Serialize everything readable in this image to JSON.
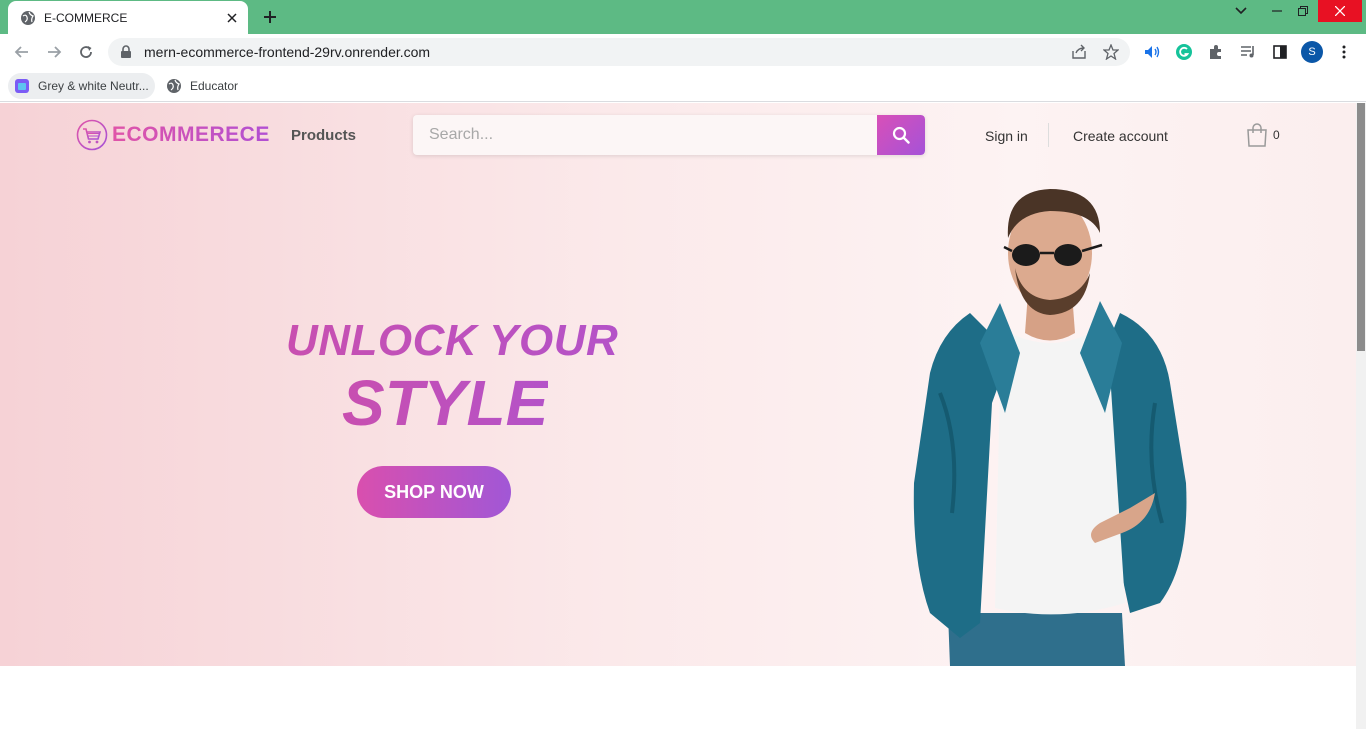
{
  "browser": {
    "tab_title": "E-COMMERCE",
    "url": "mern-ecommerce-frontend-29rv.onrender.com",
    "profile_initial": "S",
    "bookmarks": [
      {
        "label": "Grey & white Neutr..."
      },
      {
        "label": "Educator"
      }
    ]
  },
  "header": {
    "logo_text": "ECOMMERECE",
    "products_link": "Products",
    "search_placeholder": "Search...",
    "signin": "Sign in",
    "create_account": "Create account",
    "cart_count": "0"
  },
  "hero": {
    "headline_line1": "UNLOCK YOUR",
    "headline_line2": "STYLE",
    "cta": "SHOP NOW"
  },
  "colors": {
    "tabbar": "#5dba84",
    "brand_pink": "#e054a8",
    "brand_purple": "#a552d8"
  }
}
